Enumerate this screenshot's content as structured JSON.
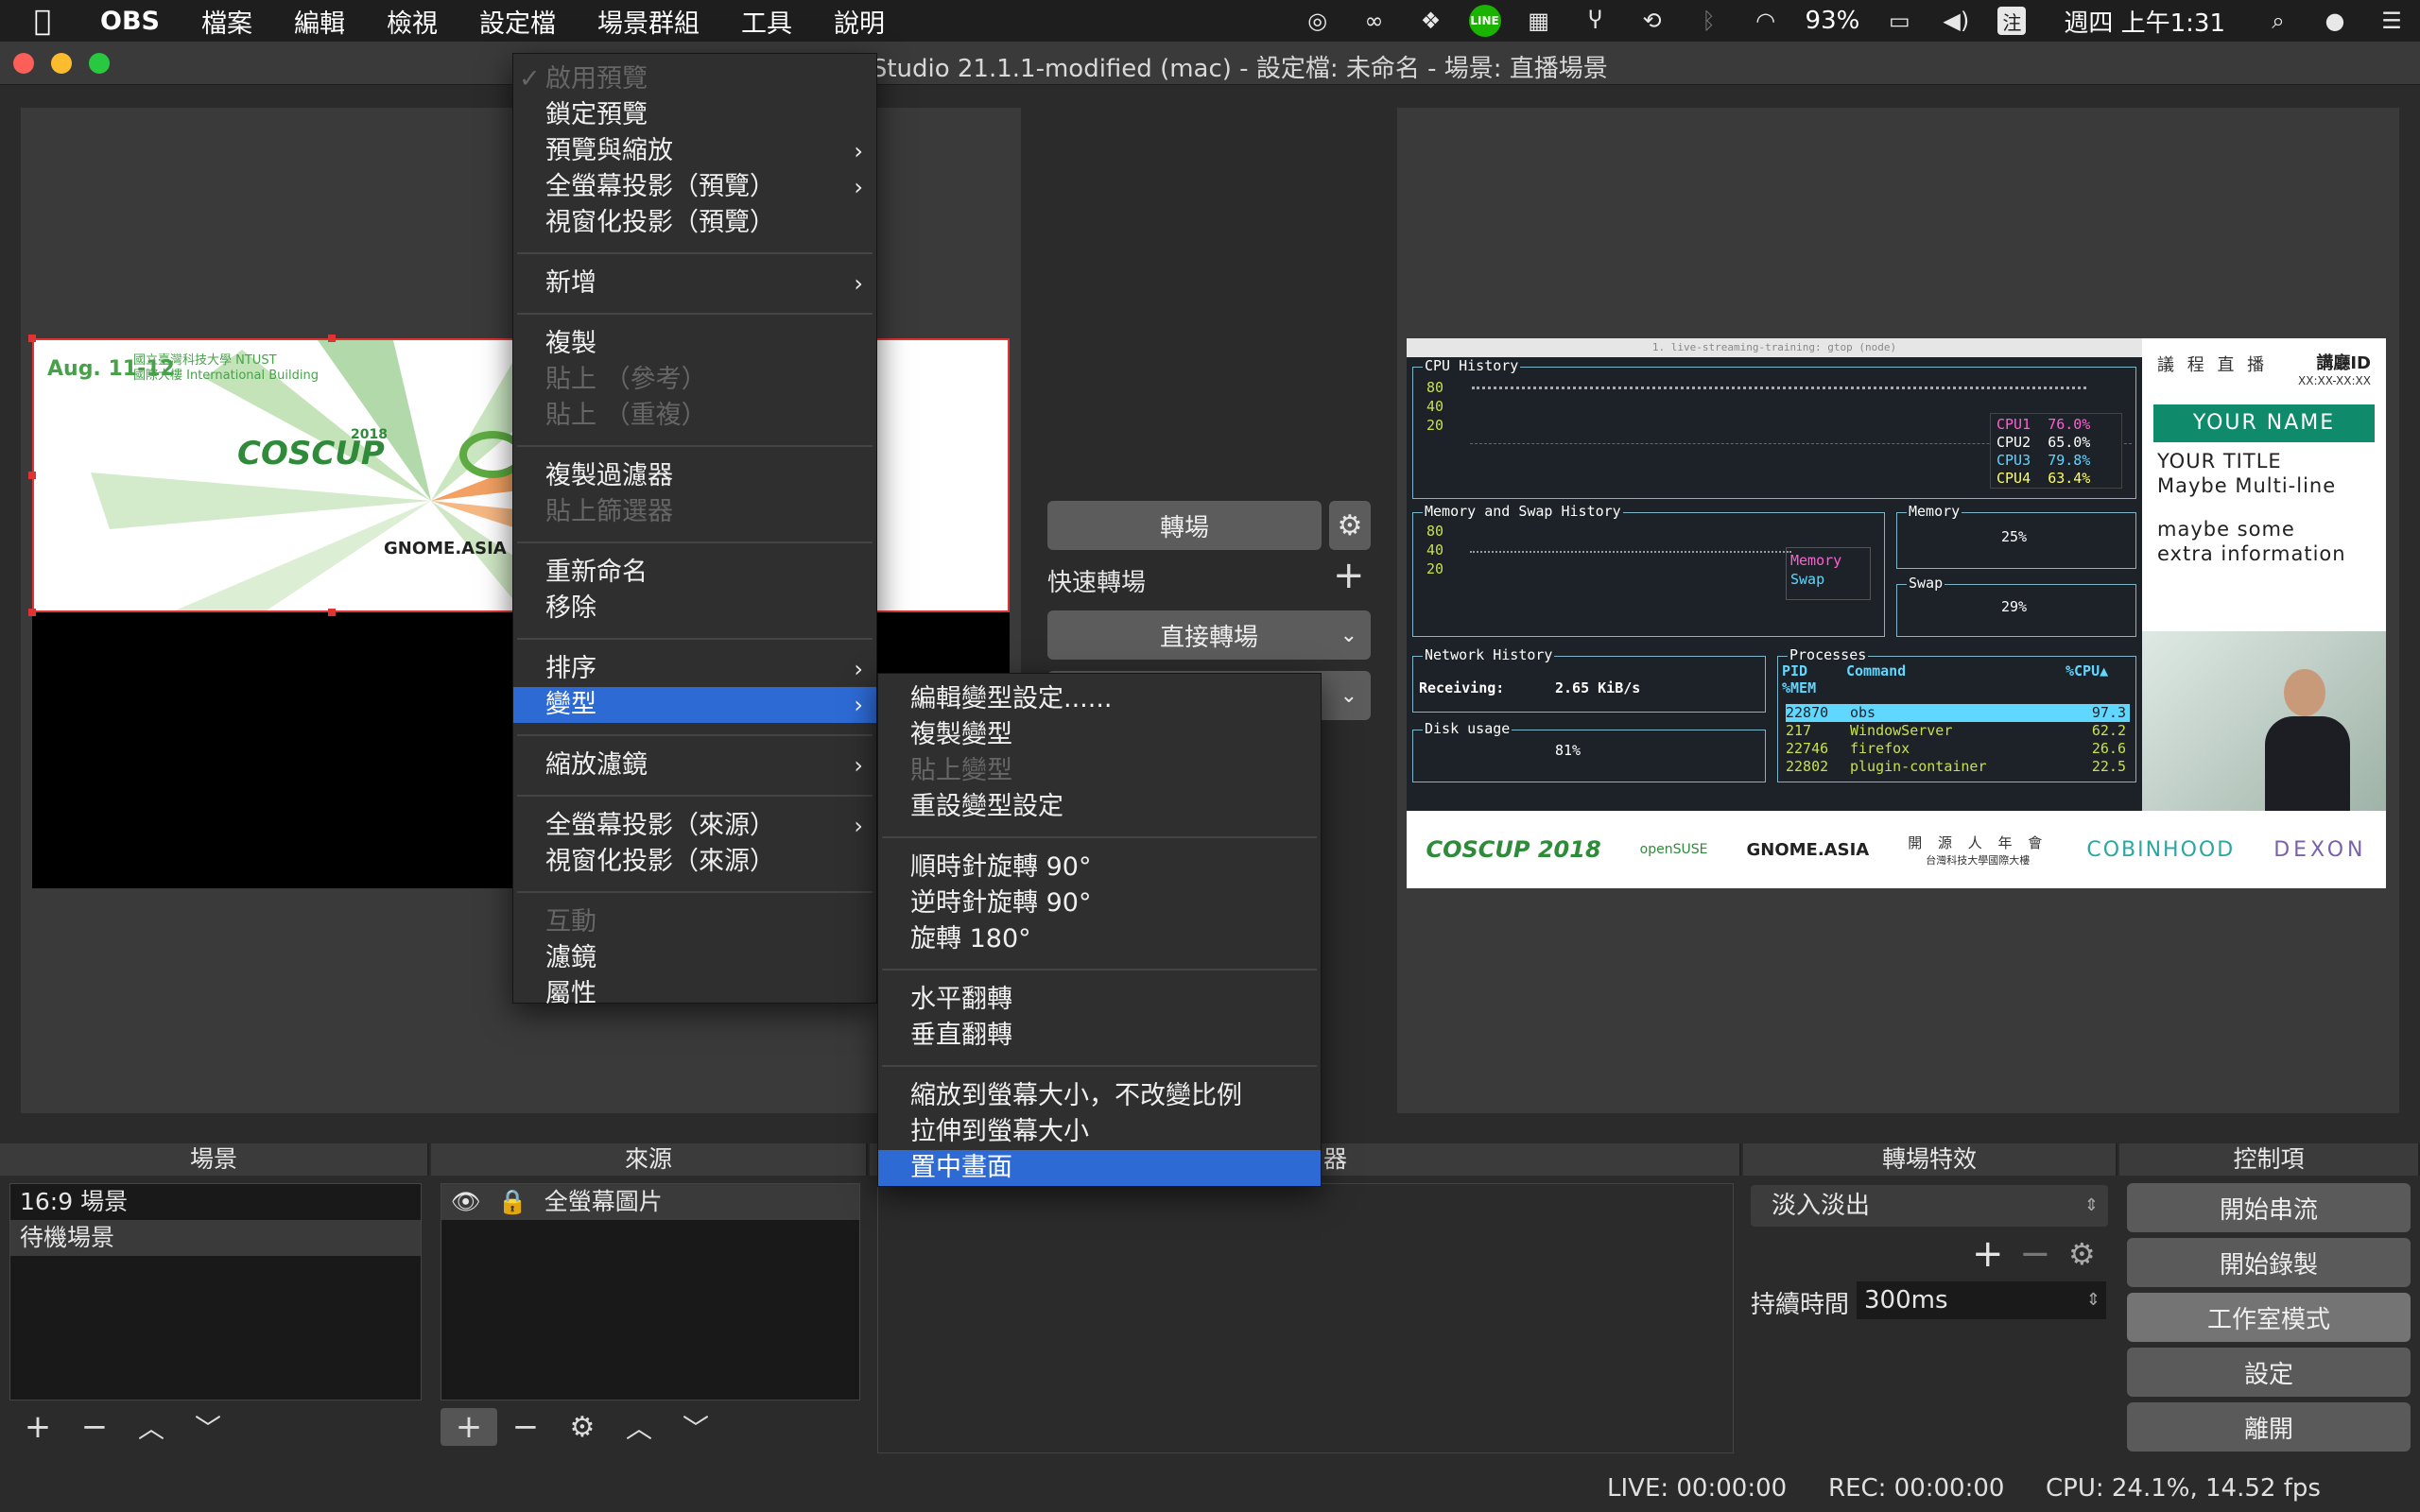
{
  "menubar": {
    "app": "OBS",
    "items": [
      "檔案",
      "編輯",
      "檢視",
      "設定檔",
      "場景群組",
      "工具",
      "說明"
    ],
    "battery": "93%",
    "ime": "注",
    "clock": "週四 上午1:31"
  },
  "window": {
    "title": "OBS Studio 21.1.1-modified (mac) - 設定檔: 未命名 - 場景: 直播場景"
  },
  "preview_slide": {
    "date": "Aug. 11-12",
    "venue_line1": "國立臺灣科技大學 NTUST",
    "venue_line2": "國際大樓 International Building",
    "logo": "COSCUP",
    "logo_year": "2018",
    "gnome": "GNOME.ASIA"
  },
  "transitions_mid": {
    "transition_button": "轉場",
    "quick_label": "快速轉場",
    "direct_button": "直接轉場"
  },
  "context_menu": {
    "items": [
      {
        "label": "啟用預覽",
        "disabled": true,
        "checked": true
      },
      {
        "label": "鎖定預覽"
      },
      {
        "label": "預覽與縮放",
        "submenu": true
      },
      {
        "label": "全螢幕投影（預覽）",
        "submenu": true
      },
      {
        "label": "視窗化投影（預覽）"
      },
      {
        "sep": true
      },
      {
        "label": "新增",
        "submenu": true
      },
      {
        "sep": true
      },
      {
        "label": "複製"
      },
      {
        "label": "貼上 （參考）",
        "disabled": true
      },
      {
        "label": "貼上 （重複）",
        "disabled": true
      },
      {
        "sep": true
      },
      {
        "label": "複製過濾器"
      },
      {
        "label": "貼上篩選器",
        "disabled": true
      },
      {
        "sep": true
      },
      {
        "label": "重新命名"
      },
      {
        "label": "移除"
      },
      {
        "sep": true
      },
      {
        "label": "排序",
        "submenu": true
      },
      {
        "label": "變型",
        "submenu": true,
        "selected": true
      },
      {
        "sep": true
      },
      {
        "label": "縮放濾鏡",
        "submenu": true
      },
      {
        "sep": true
      },
      {
        "label": "全螢幕投影（來源）",
        "submenu": true
      },
      {
        "label": "視窗化投影（來源）"
      },
      {
        "sep": true
      },
      {
        "label": "互動",
        "disabled": true
      },
      {
        "label": "濾鏡"
      },
      {
        "label": "屬性"
      }
    ]
  },
  "submenu": {
    "items": [
      {
        "label": "編輯變型設定......"
      },
      {
        "label": "複製變型"
      },
      {
        "label": "貼上變型",
        "disabled": true
      },
      {
        "label": "重設變型設定"
      },
      {
        "sep": true
      },
      {
        "label": "順時針旋轉 90°"
      },
      {
        "label": "逆時針旋轉 90°"
      },
      {
        "label": "旋轉 180°"
      },
      {
        "sep": true
      },
      {
        "label": "水平翻轉"
      },
      {
        "label": "垂直翻轉"
      },
      {
        "sep": true
      },
      {
        "label": "縮放到螢幕大小，不改變比例"
      },
      {
        "label": "拉伸到螢幕大小"
      },
      {
        "label": "置中畫面",
        "selected": true
      }
    ]
  },
  "docks": {
    "scenes_title": "場景",
    "sources_title": "來源",
    "mixer_title_partial": "器",
    "transitions_title": "轉場特效",
    "controls_title": "控制項",
    "scenes": [
      "16:9 場景",
      "待機場景"
    ],
    "sources": [
      "全螢幕圖片"
    ],
    "transition_select": "淡入淡出",
    "duration_label": "持續時間",
    "duration_value": "300ms",
    "controls": [
      "開始串流",
      "開始錄製",
      "工作室模式",
      "設定",
      "離開"
    ]
  },
  "status": {
    "live": "LIVE: 00:00:00",
    "rec": "REC: 00:00:00",
    "cpu": "CPU: 24.1%, 14.52 fps"
  },
  "program": {
    "terminal_title": "1. live-streaming-training: gtop (node)",
    "cpu_history": "CPU History",
    "cpu_ticks": [
      "80",
      "40",
      "20"
    ],
    "cpus": [
      {
        "name": "CPU1",
        "val": "76.0%",
        "color": "#ff5fd2"
      },
      {
        "name": "CPU2",
        "val": "65.0%",
        "color": "#ffffff"
      },
      {
        "name": "CPU3",
        "val": "79.8%",
        "color": "#5fd7ff"
      },
      {
        "name": "CPU4",
        "val": "63.4%",
        "color": "#ffff5f"
      }
    ],
    "mem_history": "Memory and Swap History",
    "mem_ticks": [
      "80",
      "40",
      "20"
    ],
    "mem_legend": [
      "Memory",
      "Swap"
    ],
    "memory_title": "Memory",
    "memory_pct": "25%",
    "swap_title": "Swap",
    "swap_pct": "29%",
    "net_title": "Network History",
    "receiving_label": "Receiving:",
    "receiving_value": "2.65 KiB/s",
    "disk_title": "Disk usage",
    "disk_pct": "81%",
    "proc_title": "Processes",
    "proc_headers": [
      "PID",
      "Command",
      "%CPU▲",
      "%MEM"
    ],
    "processes": [
      {
        "pid": "22870",
        "cmd": "obs",
        "cpu": "97.3"
      },
      {
        "pid": "217",
        "cmd": "WindowServer",
        "cpu": "62.2"
      },
      {
        "pid": "22746",
        "cmd": "firefox",
        "cpu": "26.6"
      },
      {
        "pid": "22802",
        "cmd": "plugin-container",
        "cpu": "22.5"
      }
    ],
    "side_title": "議 程 直 播",
    "side_speaker": "講廳ID",
    "side_time": "XX:XX-XX:XX",
    "your_name": "YOUR NAME",
    "your_title": "YOUR TITLE",
    "maybe_multi": "Maybe Multi-line",
    "maybe_some": "maybe some",
    "extra_info": "extra information",
    "sponsors": [
      "COSCUP 2018",
      "openSUSE",
      "GNOME.ASIA",
      "開 源 人 年 會",
      "COBINHOOD",
      "DEXON"
    ],
    "sponsor_sub": "台灣科技大學國際大樓"
  }
}
